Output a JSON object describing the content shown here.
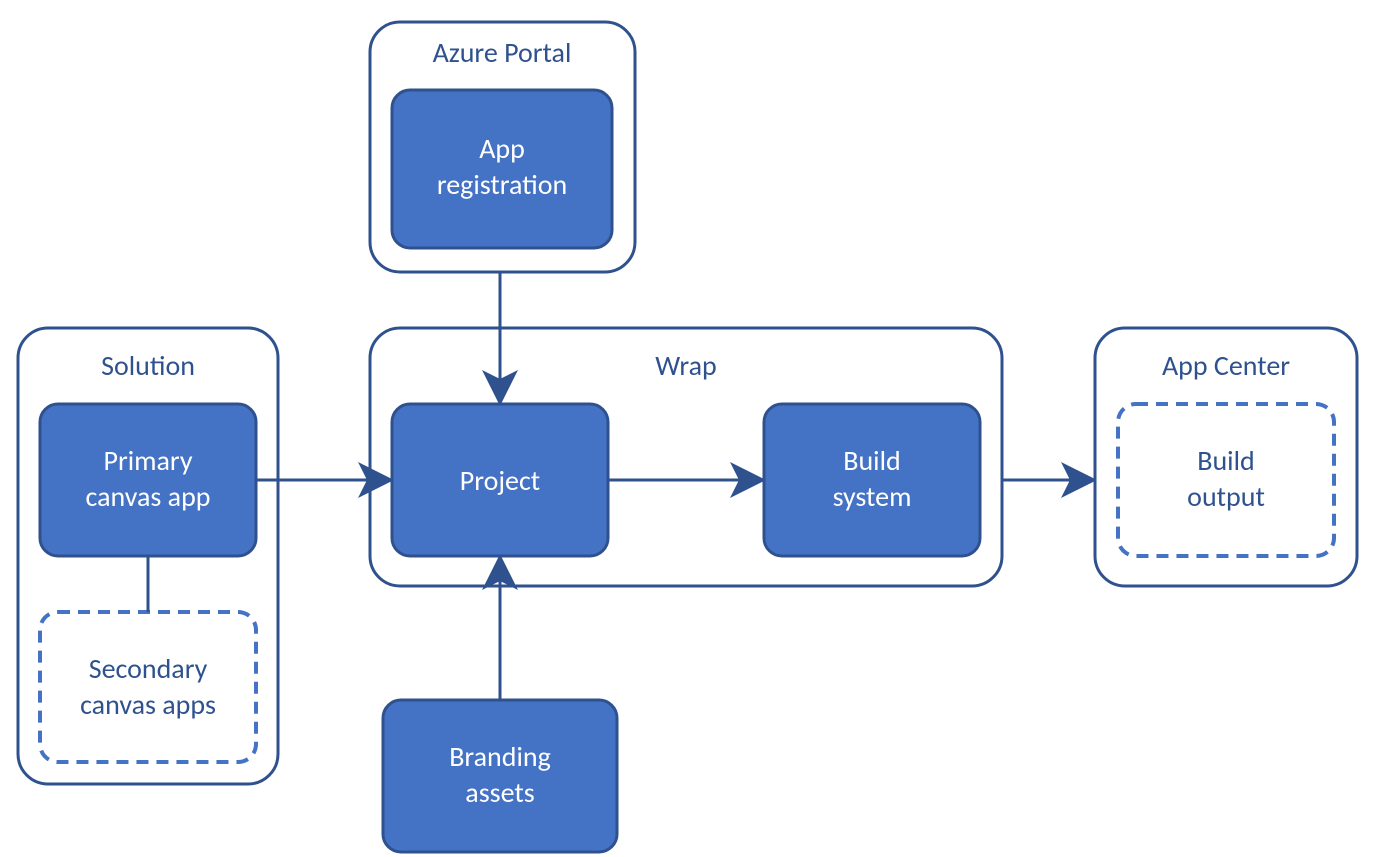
{
  "diagram": {
    "groups": {
      "azure_portal": {
        "title": "Azure Portal"
      },
      "solution": {
        "title": "Solution"
      },
      "wrap": {
        "title": "Wrap"
      },
      "app_center": {
        "title": "App Center"
      }
    },
    "nodes": {
      "app_registration": {
        "line1": "App",
        "line2": "registration"
      },
      "primary_canvas_app": {
        "line1": "Primary",
        "line2": "canvas app"
      },
      "secondary_canvas_apps": {
        "line1": "Secondary",
        "line2": "canvas apps"
      },
      "project": {
        "line1": "Project"
      },
      "build_system": {
        "line1": "Build",
        "line2": "system"
      },
      "branding_assets": {
        "line1": "Branding",
        "line2": "assets"
      },
      "build_output": {
        "line1": "Build",
        "line2": "output"
      }
    },
    "colors": {
      "stroke": "#2f528f",
      "fill": "#4472c4",
      "dashed": "#4472c4",
      "text_light": "#ffffff",
      "text_dark": "#2f528f"
    },
    "edges": [
      {
        "from": "app_registration",
        "to": "project",
        "type": "arrow"
      },
      {
        "from": "primary_canvas_app",
        "to": "project",
        "type": "arrow"
      },
      {
        "from": "primary_canvas_app",
        "to": "secondary_canvas_apps",
        "type": "line"
      },
      {
        "from": "branding_assets",
        "to": "project",
        "type": "arrow"
      },
      {
        "from": "project",
        "to": "build_system",
        "type": "arrow"
      },
      {
        "from": "build_system",
        "to": "build_output",
        "type": "arrow"
      }
    ]
  }
}
